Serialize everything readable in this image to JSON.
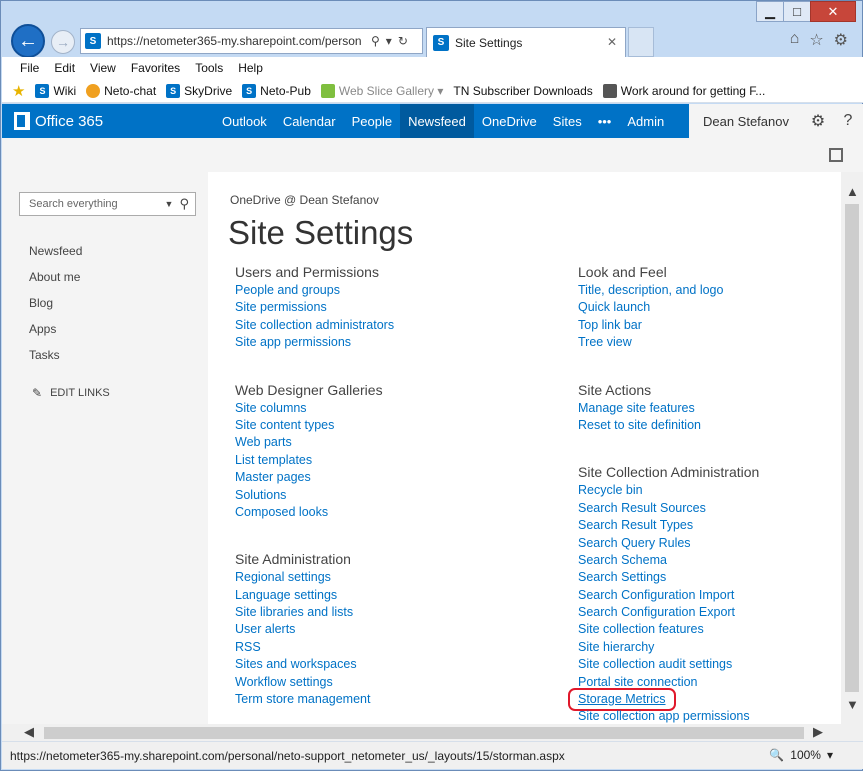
{
  "window": {
    "minimize": "▁",
    "maximize": "□",
    "close": "✕"
  },
  "address": {
    "url": "https://netometer365-my.sharepoint.com/person",
    "tab_title": "Site Settings"
  },
  "menu": [
    "File",
    "Edit",
    "View",
    "Favorites",
    "Tools",
    "Help"
  ],
  "favorites": [
    {
      "label": "Wiki",
      "icon": "sharepoint-icon",
      "color": "#0072c6",
      "dim": false
    },
    {
      "label": "Neto-chat",
      "icon": "orange-circle-icon",
      "color": "#f0a020",
      "dim": false
    },
    {
      "label": "SkyDrive",
      "icon": "sharepoint-icon",
      "color": "#0072c6",
      "dim": false
    },
    {
      "label": "Neto-Pub",
      "icon": "sharepoint-icon",
      "color": "#0072c6",
      "dim": false
    },
    {
      "label": "Web Slice Gallery ▾",
      "icon": "web-slice-icon",
      "color": "#7fbf3f",
      "dim": true
    },
    {
      "label": "TN Subscriber Downloads",
      "icon": "",
      "color": "",
      "dim": false
    },
    {
      "label": "Work around for getting F...",
      "icon": "grid-icon",
      "color": "#555555",
      "dim": false
    }
  ],
  "suite": {
    "brand": "Office 365",
    "nav": [
      {
        "label": "Outlook",
        "active": false
      },
      {
        "label": "Calendar",
        "active": false
      },
      {
        "label": "People",
        "active": false
      },
      {
        "label": "Newsfeed",
        "active": true
      },
      {
        "label": "OneDrive",
        "active": false
      },
      {
        "label": "Sites",
        "active": false
      },
      {
        "label": "•••",
        "active": false
      },
      {
        "label": "Admin",
        "active": false
      }
    ],
    "user": "Dean Stefanov",
    "accent": "#0072c6"
  },
  "leftnav": {
    "search_placeholder": "Search everything",
    "items": [
      "Newsfeed",
      "About me",
      "Blog",
      "Apps",
      "Tasks"
    ],
    "edit_links": "EDIT LINKS"
  },
  "content": {
    "breadcrumb": "OneDrive @ Dean Stefanov",
    "title": "Site Settings",
    "left_groups": [
      {
        "heading": "Users and Permissions",
        "links": [
          "People and groups",
          "Site permissions",
          "Site collection administrators",
          "Site app permissions"
        ]
      },
      {
        "heading": "Web Designer Galleries",
        "links": [
          "Site columns",
          "Site content types",
          "Web parts",
          "List templates",
          "Master pages",
          "Solutions",
          "Composed looks"
        ]
      },
      {
        "heading": "Site Administration",
        "links": [
          "Regional settings",
          "Language settings",
          "Site libraries and lists",
          "User alerts",
          "RSS",
          "Sites and workspaces",
          "Workflow settings",
          "Term store management"
        ]
      }
    ],
    "right_groups": [
      {
        "heading": "Look and Feel",
        "links": [
          "Title, description, and logo",
          "Quick launch",
          "Top link bar",
          "Tree view"
        ]
      },
      {
        "heading": "Site Actions",
        "links": [
          "Manage site features",
          "Reset to site definition"
        ]
      },
      {
        "heading": "Site Collection Administration",
        "links": [
          "Recycle bin",
          "Search Result Sources",
          "Search Result Types",
          "Search Query Rules",
          "Search Schema",
          "Search Settings",
          "Search Configuration Import",
          "Search Configuration Export",
          "Site collection features",
          "Site hierarchy",
          "Site collection audit settings",
          "Portal site connection",
          "Storage Metrics",
          "Site collection app permissions"
        ]
      }
    ],
    "highlighted_link": "Storage Metrics"
  },
  "status": {
    "url": "https://netometer365-my.sharepoint.com/personal/neto-support_netometer_us/_layouts/15/storman.aspx",
    "zoom": "100%"
  }
}
